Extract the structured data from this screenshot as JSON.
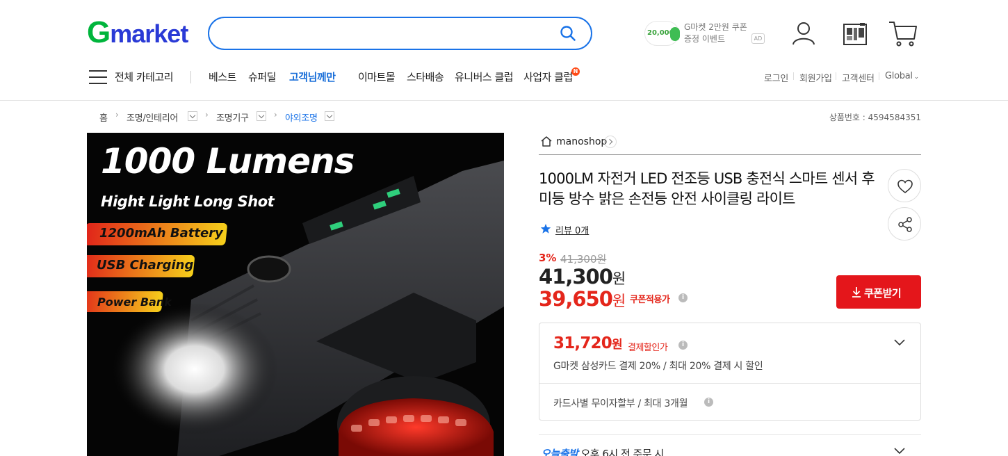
{
  "header": {
    "logo_g": "G",
    "logo_rest": "market",
    "search": {
      "placeholder": ""
    },
    "ad": {
      "amount": "20,000",
      "line1": "G마켓 2만원 쿠폰",
      "line2": "증정 이벤트",
      "label": "AD"
    }
  },
  "nav": {
    "all_categories": "전체 카테고리",
    "items": [
      "베스트",
      "슈퍼딜",
      "고객님께만",
      "이마트몰",
      "스타배송",
      "유니버스 클럽",
      "사업자 클럽"
    ],
    "new_badge": "N",
    "util": [
      "로그인",
      "회원가입",
      "고객센터",
      "Global"
    ]
  },
  "breadcrumb": {
    "items": [
      "홈",
      "조명/인테리어",
      "조명기구",
      "야외조명"
    ],
    "product_id": "상품번호 : 4594584351"
  },
  "product_image": {
    "headline": "1000 Lumens",
    "subline": "Hight Light Long Shot",
    "tags": [
      "1200mAh Battery",
      "USB Charging",
      "Power Bank"
    ]
  },
  "product": {
    "shop_name": "manoshop",
    "title": "1000LM 자전거 LED 전조등 USB 충전식 스마트 센서 후미등 방수 밝은 손전등 안전 사이클링 라이트",
    "review": "리뷰 0개",
    "discount_pct": "3%",
    "original_price": "41,300원",
    "price": "41,300",
    "price_unit": "원",
    "coupon_price": "39,650",
    "coupon_label": "쿠폰적용가",
    "coupon_button": "쿠폰받기",
    "payment": {
      "price": "31,720",
      "unit": "원",
      "label": "결제할인가",
      "description": "G마켓 삼성카드 결제 20% / 최대 20% 결제 시 할인",
      "installment": "카드사별 무이자할부 / 최대 3개월"
    },
    "delivery": {
      "brand": "오늘출발",
      "text": "오후 6시 전 주문 시"
    }
  },
  "colors": {
    "brand_green": "#00b53c",
    "brand_blue": "#2a3ad6",
    "accent_red": "#e4261b",
    "link_blue": "#1a73e8"
  }
}
